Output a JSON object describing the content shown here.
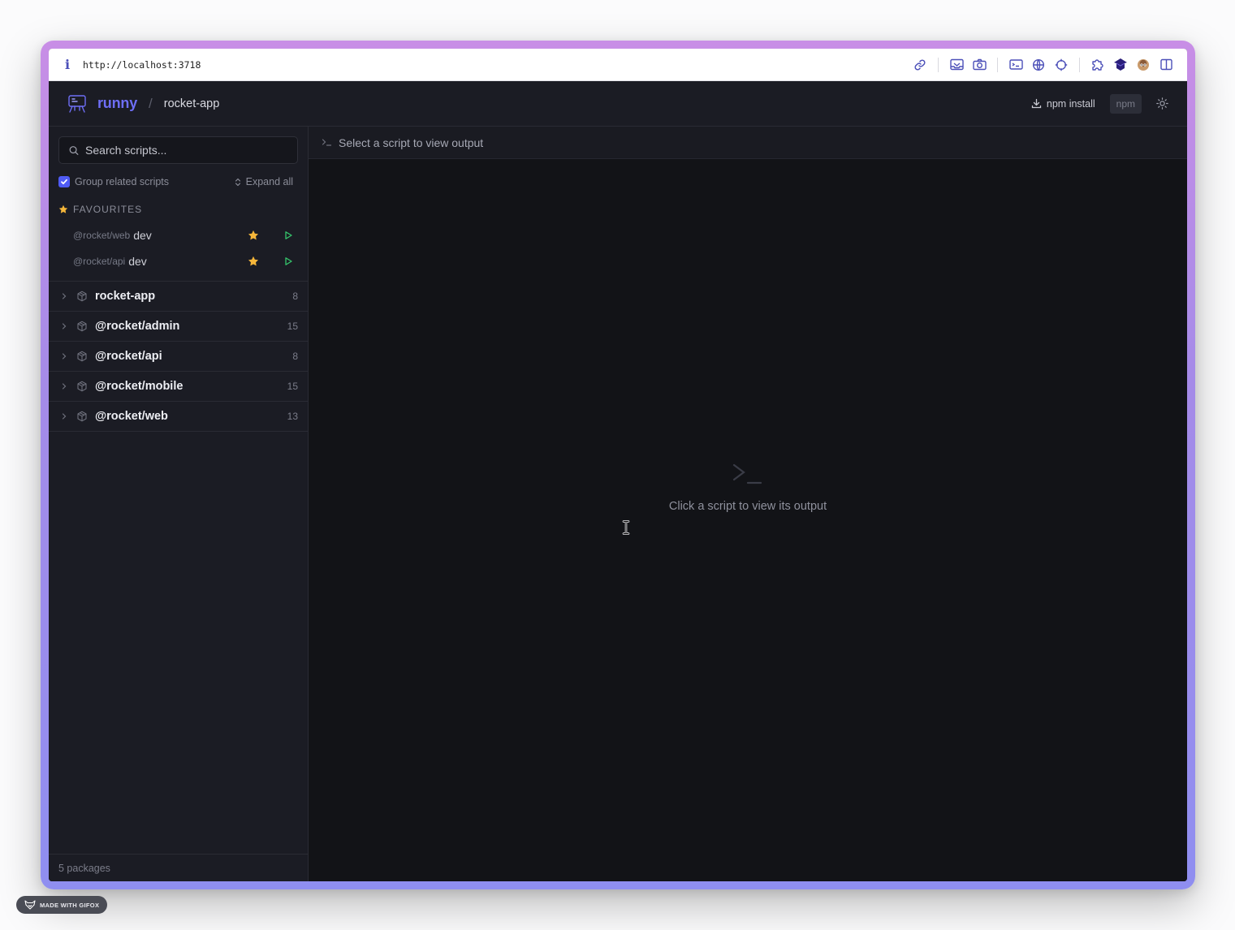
{
  "browser": {
    "info_icon": "info-icon",
    "url": "http://localhost:3718",
    "toolbar_icons": [
      "link-icon",
      "inbox-icon",
      "camera-icon",
      "terminal-icon",
      "globe-icon",
      "crosshair-icon",
      "puzzle-icon",
      "extension-icon",
      "avatar-icon",
      "sidebar-icon"
    ]
  },
  "header": {
    "brand": "runny",
    "separator": "/",
    "project": "rocket-app",
    "npm_install_label": "npm install",
    "package_manager": "npm"
  },
  "sidebar": {
    "search_placeholder": "Search scripts...",
    "group_label": "Group related scripts",
    "group_checked": true,
    "expand_label": "Expand all",
    "favourites_title": "FAVOURITES",
    "favourites": [
      {
        "package": "@rocket/web",
        "script": "dev"
      },
      {
        "package": "@rocket/api",
        "script": "dev"
      }
    ],
    "packages": [
      {
        "name": "rocket-app",
        "count": "8"
      },
      {
        "name": "@rocket/admin",
        "count": "15"
      },
      {
        "name": "@rocket/api",
        "count": "8"
      },
      {
        "name": "@rocket/mobile",
        "count": "15"
      },
      {
        "name": "@rocket/web",
        "count": "13"
      }
    ],
    "footer": "5 packages"
  },
  "main": {
    "bar_text": "Select a script to view output",
    "empty_text": "Click a script to view its output"
  },
  "watermark": "MADE WITH GIFOX",
  "colors": {
    "accent": "#6e6ef5",
    "star": "#f5b63a",
    "play": "#35c46b",
    "frame_gradient_top": "#c88ee6",
    "frame_gradient_bottom": "#8f8ef0"
  }
}
